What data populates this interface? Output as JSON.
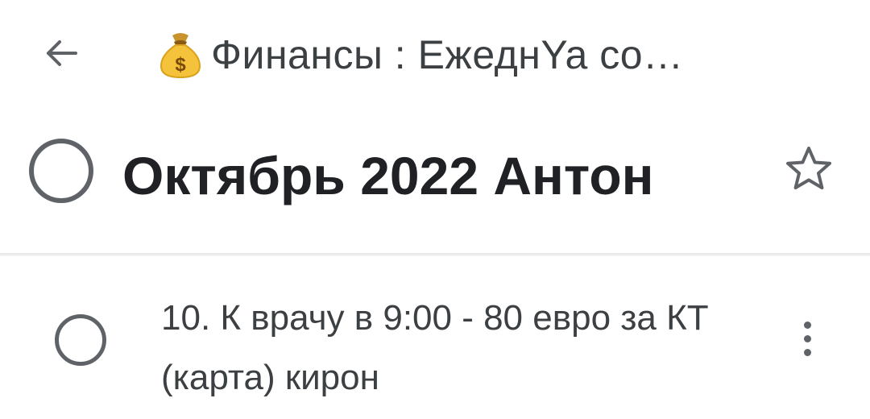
{
  "app_bar": {
    "back_icon": "arrow-left-icon",
    "title_emoji_icon": "money-bag-icon",
    "title": "Финансы : ЕжеднYa co…"
  },
  "task": {
    "title": "Октябрь 2022 Антон",
    "completed": false,
    "starred": false,
    "checkbox_icon": "circle-checkbox-icon",
    "star_icon": "star-outline-icon"
  },
  "subtasks": [
    {
      "text": "10. К врачу в 9:00 - 80 евро за КТ (карта) кирон",
      "completed": false,
      "menu_icon": "more-vertical-icon"
    }
  ],
  "colors": {
    "icon_gray": "#5f6368",
    "title_text": "#202124",
    "body_text": "#3c4043",
    "background": "#ffffff"
  }
}
